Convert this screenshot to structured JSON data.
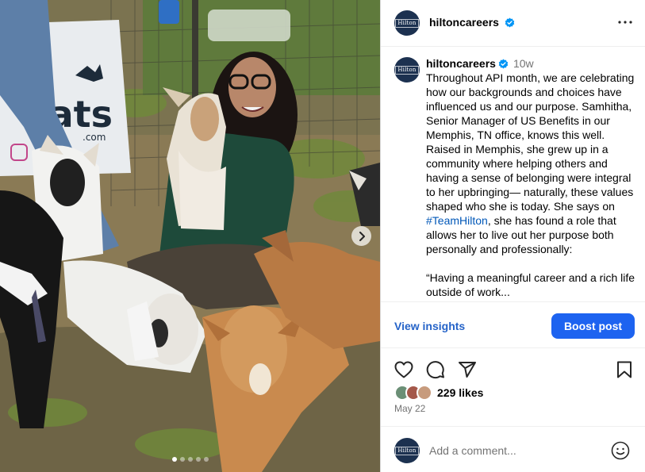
{
  "post": {
    "username": "hiltoncareers",
    "avatar_logo_text": "Hilton",
    "time_ago": "10w",
    "caption_before_hashtag": "Throughout API month, we are celebrating how our backgrounds and choices have influenced us and our purpose. Samhitha, Senior Manager of US Benefits in our Memphis, TN office, knows this well. Raised in Memphis, she grew up in a community where helping others and having a sense of belonging were integral to her upbringing— naturally, these values shaped who she is today. She says on ",
    "hashtag": "#TeamHilton",
    "caption_after_hashtag": ", she has found a role that allows her to live out her purpose both personally and professionally:",
    "caption_quote": "“Having a meaningful career and a rich life outside of work...",
    "likes": "229 likes",
    "date": "May 22"
  },
  "insights": {
    "view_label": "View insights",
    "boost_label": "Boost post"
  },
  "comment": {
    "placeholder": "Add a comment..."
  },
  "media": {
    "banner_text": "oats",
    "banner_subtext": ".com",
    "carousel": {
      "slide_count": 5,
      "active_index": 0
    }
  },
  "colors": {
    "brand_navy": "#1c3150",
    "boost_blue": "#1d63f0",
    "link_blue": "#2563c8",
    "verified_blue": "#0095f6"
  },
  "icons": [
    "more-icon",
    "verified-badge-icon",
    "chevron-right-icon",
    "heart-icon",
    "comment-icon",
    "share-icon",
    "bookmark-icon",
    "emoji-icon"
  ]
}
